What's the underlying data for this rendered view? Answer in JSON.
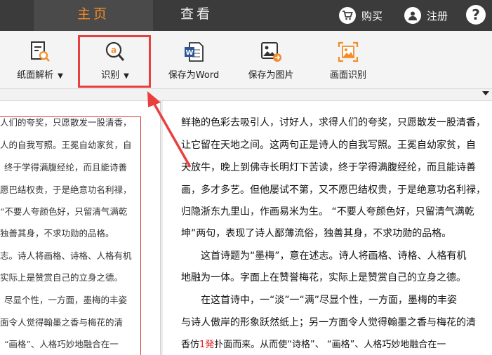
{
  "top_bar": {
    "tabs": [
      {
        "label": "主页",
        "active": true
      },
      {
        "label": "查看",
        "active": false
      }
    ],
    "buy_label": "购买",
    "register_label": "注册",
    "help_label": "?"
  },
  "toolbar": {
    "tools": [
      {
        "label": "纸面解析",
        "has_dropdown": true,
        "icon": "document-search-icon"
      },
      {
        "label": "识别",
        "has_dropdown": true,
        "icon": "recognize-icon",
        "highlighted": true
      },
      {
        "label": "保存为Word",
        "has_dropdown": false,
        "icon": "word-icon"
      },
      {
        "label": "保存为图片",
        "has_dropdown": false,
        "icon": "save-image-icon"
      },
      {
        "label": "画面识别",
        "has_dropdown": false,
        "icon": "screen-recognize-icon"
      }
    ]
  },
  "left_pane": {
    "lines": [
      "人们的夸奖，只愿散发一股清香，",
      "人的自我写照。王冕自幼家贫，自",
      "终于学得满腹经纶，而且能诗善",
      "愿巴结权贵，于是绝意功名利禄，",
      "“不要人夸颜色好，只留清气满乾",
      "独善其身，不求功勋的品格。",
      "志。诗人将画格、诗格、人格有机",
      "实际上是赞赏自己的立身之德。",
      "尽显个性，一方面，墨梅的丰姿",
      "面令人觉得翰墨之香与梅花的清",
      "“画格”、人格巧妙地融合在一"
    ]
  },
  "right_pane": {
    "lines": [
      {
        "text": "鲜艳的色彩去吸引人，讨好人，求得人们的夸奖，只愿散发一股清香，",
        "indent": false
      },
      {
        "text": "让它留在天地之间。这两句正是诗人的自我写照。王冕自幼家贫，自",
        "indent": false
      },
      {
        "text": "天放牛，晚上到佛寺长明灯下苦读，终于学得满腹经纶，而且能诗善",
        "indent": false
      },
      {
        "text": "画，多才多艺。但他屡试不第，又不愿巴结权贵，于是绝意功名利禄，",
        "indent": false
      },
      {
        "text": "归隐浙东九里山，作画易米为生。   “不要人夸颜色好，只留清气满乾",
        "indent": false
      },
      {
        "text": "坤”两句，表现了诗人鄙薄流俗，独善其身，不求功勋的品格。",
        "indent": false
      },
      {
        "text": "这首诗题为“墨梅”，意在述志。诗人将画格、诗格、人格有机",
        "indent": true
      },
      {
        "text": "地融为一体。字面上在赞誉梅花，实际上是赞赏自己的立身之德。",
        "indent": false
      },
      {
        "text": "在这首诗中，一“淡”一“满”尽显个性，一方面，墨梅的丰姿",
        "indent": true
      },
      {
        "text": "与诗人傲岸的形象跃然纸上；另一方面令人觉得翰墨之香与梅花的清",
        "indent": false
      }
    ],
    "last_line_before": "香仿",
    "last_line_red": "1発",
    "last_line_after": "扑面而来。从而使“诗格”、 “画格”、人格巧妙地融合在一"
  },
  "colors": {
    "top_bar_bg": "#3b3b3b",
    "active_tab_text": "#f28c28",
    "highlight_red": "#e8403e"
  }
}
